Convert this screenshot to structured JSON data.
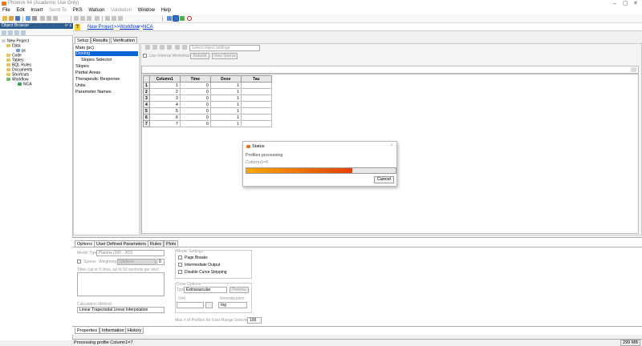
{
  "window": {
    "title": "Phoenix 64 (Academic Use Only)",
    "minimize": "–",
    "maximize": "▢",
    "close": "✕"
  },
  "menu": [
    {
      "label": "File",
      "enabled": true
    },
    {
      "label": "Edit",
      "enabled": true
    },
    {
      "label": "Insert",
      "enabled": true
    },
    {
      "label": "Send To",
      "enabled": false
    },
    {
      "label": "PKS",
      "enabled": true
    },
    {
      "label": "Watson",
      "enabled": true
    },
    {
      "label": "Validation",
      "enabled": false
    },
    {
      "label": "Window",
      "enabled": true
    },
    {
      "label": "Help",
      "enabled": true
    }
  ],
  "object_browser": {
    "title": "Object Browser",
    "pin": "⊳ x",
    "tree": [
      {
        "label": "New Project",
        "icon": "project-icon"
      },
      {
        "label": "Data",
        "icon": "folder-icon"
      },
      {
        "label": "pc",
        "icon": "worksheet-icon"
      },
      {
        "label": "Code",
        "icon": "folder-icon"
      },
      {
        "label": "Tables",
        "icon": "folder-icon"
      },
      {
        "label": "BQL Rules",
        "icon": "folder-icon"
      },
      {
        "label": "Documents",
        "icon": "folder-icon"
      },
      {
        "label": "Shortcuts",
        "icon": "folder-icon"
      },
      {
        "label": "Workflow",
        "icon": "workflow-icon"
      },
      {
        "label": "NCA",
        "icon": "nca-icon"
      }
    ]
  },
  "breadcrumb": {
    "part1": "New Project",
    "sep": ">>",
    "part2": "Workflow",
    "part3": "NCA"
  },
  "top_tabs": [
    "Setup",
    "Results",
    "Verification"
  ],
  "setup_nav": [
    {
      "label": "Main (pc)"
    },
    {
      "label": "Dosing"
    },
    {
      "label": "Slopes Selector"
    },
    {
      "label": "Slopes"
    },
    {
      "label": "Partial Areas"
    },
    {
      "label": "Therapeutic Response"
    },
    {
      "label": "Units"
    },
    {
      "label": "Parameter Names"
    }
  ],
  "worksheet_toolbar": {
    "select_placeholder": "Select object settings",
    "use_internal": "Use Internal Worksheet",
    "rebuild": "Rebuild",
    "view_source": "View Source"
  },
  "grid": {
    "columns": [
      "Column1",
      "Time",
      "Dose",
      "Tau"
    ],
    "rows": [
      [
        "1",
        "1",
        "0",
        "1"
      ],
      [
        "2",
        "2",
        "0",
        "1"
      ],
      [
        "3",
        "3",
        "0",
        "1"
      ],
      [
        "4",
        "4",
        "0",
        "1"
      ],
      [
        "5",
        "5",
        "0",
        "1"
      ],
      [
        "6",
        "6",
        "0",
        "1"
      ],
      [
        "7",
        "7",
        "0",
        "1"
      ]
    ]
  },
  "status_dialog": {
    "title": "Status",
    "message": "Profiles processing",
    "profile": "Column1=6",
    "progress": 0.71,
    "cancel": "Cancel",
    "close": "×",
    "bar_colors": {
      "start": "#f5a800",
      "end": "#e8400c"
    }
  },
  "option_tabs": [
    "Options",
    "User Defined Parameters",
    "Rules",
    "Plots"
  ],
  "options": {
    "model_type_label": "Model Type",
    "model_type_value": "Plasma (200 - 202)",
    "sparse": "Sparse",
    "weighting_label": "Weighting",
    "weighting_value": "Uniform",
    "weighting_num": "0",
    "title_hint": "Titles (up to 5 lines, up to 50 symbols per line)",
    "calc_method_label": "Calculation Method",
    "calc_method_value": "Linear Trapezoidal Linear Interpolation",
    "model_settings": "Model Settings",
    "page_breaks": "Page Breaks",
    "intermediate_output": "Intermediate Output",
    "disable_curve": "Disable Curve Stripping",
    "dose_options": "Dose Options",
    "type_label": "Type",
    "type_value": "Extravascular",
    "preview": "Preview",
    "unit_label": "Unit",
    "normalization_label": "Normalization",
    "normalization_value": "mg",
    "max_profiles_label": "Max # of Profiles for User Range Selections",
    "max_profiles_value": "100"
  },
  "bottom_tabs": [
    "Properties",
    "Information",
    "History"
  ],
  "status_bar": {
    "text": "Processing profile Column1=7",
    "memory": "299 MB"
  }
}
